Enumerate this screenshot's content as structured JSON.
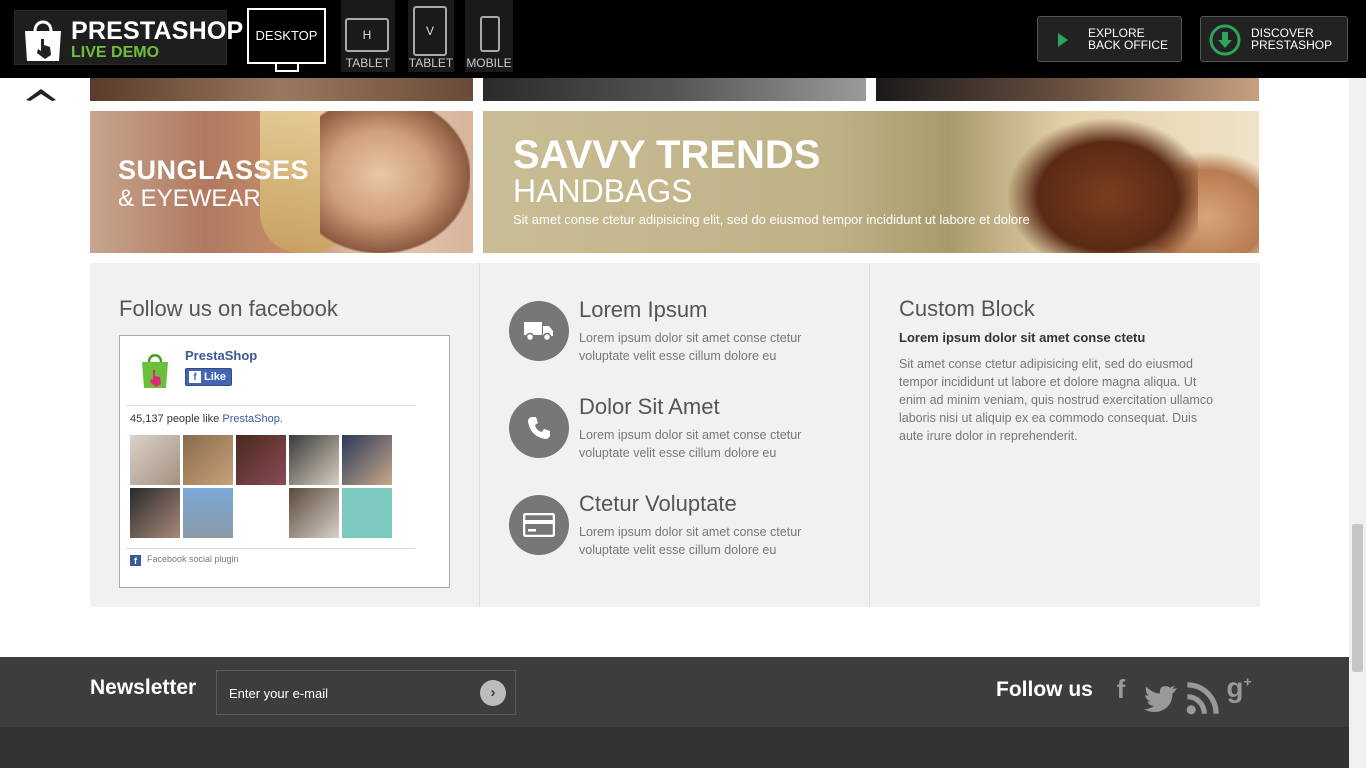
{
  "topbar": {
    "logo_brand": "PRESTASHOP",
    "logo_sub": "LIVE DEMO",
    "devices": {
      "desktop": "DESKTOP",
      "tablet_h_icon": "H",
      "tablet_h": "TABLET",
      "tablet_v_icon": "V",
      "tablet_v": "TABLET",
      "mobile": "MOBILE"
    },
    "explore_line1": "EXPLORE",
    "explore_line2": "BACK OFFICE",
    "discover_line1": "DISCOVER",
    "discover_line2": "PRESTASHOP"
  },
  "banners": {
    "sunglasses_title": "SUNGLASSES",
    "sunglasses_sub": "& EYEWEAR",
    "handbags_title": "SAVVY TRENDS",
    "handbags_sub": "HANDBAGS",
    "handbags_text": "Sit amet conse ctetur adipisicing elit, sed do eiusmod tempor incididunt ut labore et dolore"
  },
  "facebook": {
    "title": "Follow us on facebook",
    "page_name": "PrestaShop",
    "like": "Like",
    "count_text": "45,137 people like ",
    "count_link": "PrestaShop.",
    "plugin": "Facebook social plugin"
  },
  "features": [
    {
      "title": "Lorem Ipsum",
      "text": "Lorem ipsum dolor sit amet conse ctetur voluptate velit esse cillum dolore eu",
      "icon": "truck-icon"
    },
    {
      "title": "Dolor Sit Amet",
      "text": "Lorem ipsum dolor sit amet conse ctetur voluptate velit esse cillum dolore eu",
      "icon": "phone-icon"
    },
    {
      "title": "Ctetur Voluptate",
      "text": "Lorem ipsum dolor sit amet conse ctetur voluptate velit esse cillum dolore eu",
      "icon": "credit-card-icon"
    }
  ],
  "custom_block": {
    "title": "Custom Block",
    "subtitle": "Lorem ipsum dolor sit amet conse ctetu",
    "body": "Sit amet conse ctetur adipisicing elit, sed do eiusmod tempor incididunt ut labore et dolore magna aliqua. Ut enim ad minim veniam, quis nostrud exercitation ullamco laboris nisi ut aliquip ex ea commodo consequat. Duis aute irure dolor in reprehenderit."
  },
  "newsletter": {
    "label": "Newsletter",
    "placeholder": "Enter your e-mail",
    "follow_label": "Follow us",
    "social": [
      "facebook-icon",
      "twitter-icon",
      "rss-icon",
      "google-plus-icon"
    ]
  },
  "colors": {
    "topbar": "#000000",
    "accent_green": "#6fbf3b",
    "footer": "#3d3d3d",
    "info_bg": "#f1f1f1"
  }
}
